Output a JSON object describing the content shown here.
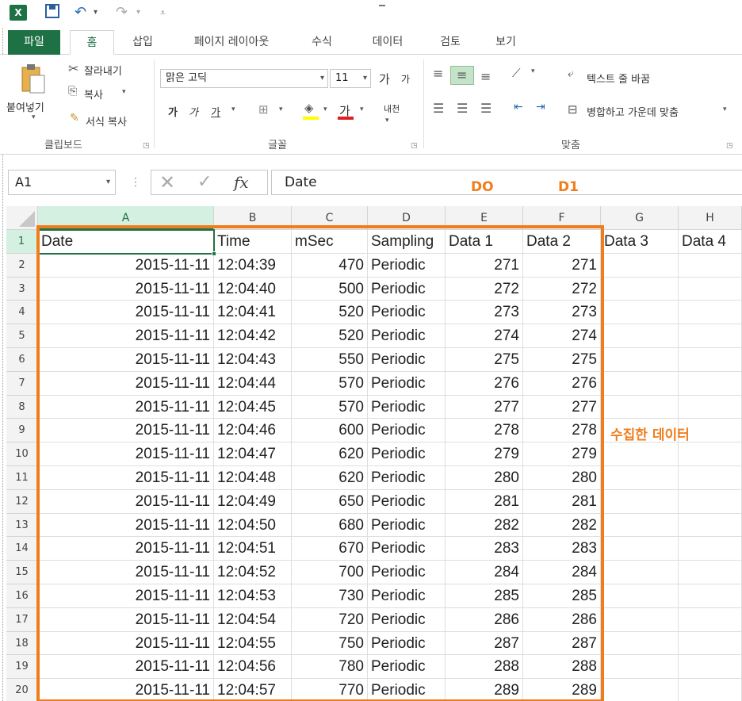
{
  "qat": {
    "logo": "X",
    "save_icon": "floppy-icon",
    "undo_icon": "undo-icon",
    "redo_icon": "redo-icon"
  },
  "tabs": {
    "file": "파일",
    "home": "홈",
    "insert": "삽입",
    "page_layout": "페이지 레이아웃",
    "formulas": "수식",
    "data": "데이터",
    "review": "검토",
    "view": "보기"
  },
  "ribbon": {
    "clipboard": {
      "paste": "붙여넣기",
      "cut": "잘라내기",
      "copy": "복사",
      "format_painter": "서식 복사",
      "label": "클립보드"
    },
    "font": {
      "name": "맑은 고딕",
      "size": "11",
      "grow": "가",
      "shrink": "가",
      "bold": "가",
      "italic": "가",
      "underline": "가",
      "font_color": "가",
      "phonetic": "내천",
      "label": "글꼴"
    },
    "alignment": {
      "wrap_text": "텍스트 줄 바꿈",
      "merge_center": "병합하고 가운데 맞춤",
      "label": "맞춤"
    }
  },
  "formula_bar": {
    "name_box": "A1",
    "fx": "fx",
    "value": "Date"
  },
  "annotations": {
    "d0": "DO",
    "d1": "D1",
    "collected": "수집한 데이터"
  },
  "grid": {
    "columns": [
      "A",
      "B",
      "C",
      "D",
      "E",
      "F",
      "G",
      "H"
    ],
    "header_row": [
      "Date",
      "Time",
      "mSec",
      "Sampling",
      "Data 1",
      "Data 2",
      "Data 3",
      "Data 4"
    ],
    "row_numbers": [
      "1",
      "2",
      "3",
      "4",
      "5",
      "6",
      "7",
      "8",
      "9",
      "10",
      "11",
      "12",
      "13",
      "14",
      "15",
      "16",
      "17",
      "18",
      "19",
      "20"
    ],
    "rows": [
      [
        "2015-11-11",
        "12:04:39",
        "470",
        "Periodic",
        "271",
        "271"
      ],
      [
        "2015-11-11",
        "12:04:40",
        "500",
        "Periodic",
        "272",
        "272"
      ],
      [
        "2015-11-11",
        "12:04:41",
        "520",
        "Periodic",
        "273",
        "273"
      ],
      [
        "2015-11-11",
        "12:04:42",
        "520",
        "Periodic",
        "274",
        "274"
      ],
      [
        "2015-11-11",
        "12:04:43",
        "550",
        "Periodic",
        "275",
        "275"
      ],
      [
        "2015-11-11",
        "12:04:44",
        "570",
        "Periodic",
        "276",
        "276"
      ],
      [
        "2015-11-11",
        "12:04:45",
        "570",
        "Periodic",
        "277",
        "277"
      ],
      [
        "2015-11-11",
        "12:04:46",
        "600",
        "Periodic",
        "278",
        "278"
      ],
      [
        "2015-11-11",
        "12:04:47",
        "620",
        "Periodic",
        "279",
        "279"
      ],
      [
        "2015-11-11",
        "12:04:48",
        "620",
        "Periodic",
        "280",
        "280"
      ],
      [
        "2015-11-11",
        "12:04:49",
        "650",
        "Periodic",
        "281",
        "281"
      ],
      [
        "2015-11-11",
        "12:04:50",
        "680",
        "Periodic",
        "282",
        "282"
      ],
      [
        "2015-11-11",
        "12:04:51",
        "670",
        "Periodic",
        "283",
        "283"
      ],
      [
        "2015-11-11",
        "12:04:52",
        "700",
        "Periodic",
        "284",
        "284"
      ],
      [
        "2015-11-11",
        "12:04:53",
        "730",
        "Periodic",
        "285",
        "285"
      ],
      [
        "2015-11-11",
        "12:04:54",
        "720",
        "Periodic",
        "286",
        "286"
      ],
      [
        "2015-11-11",
        "12:04:55",
        "750",
        "Periodic",
        "287",
        "287"
      ],
      [
        "2015-11-11",
        "12:04:56",
        "780",
        "Periodic",
        "288",
        "288"
      ],
      [
        "2015-11-11",
        "12:04:57",
        "770",
        "Periodic",
        "289",
        "289"
      ]
    ]
  },
  "colors": {
    "excel_green": "#217346",
    "annotation_orange": "#f07d1c"
  }
}
